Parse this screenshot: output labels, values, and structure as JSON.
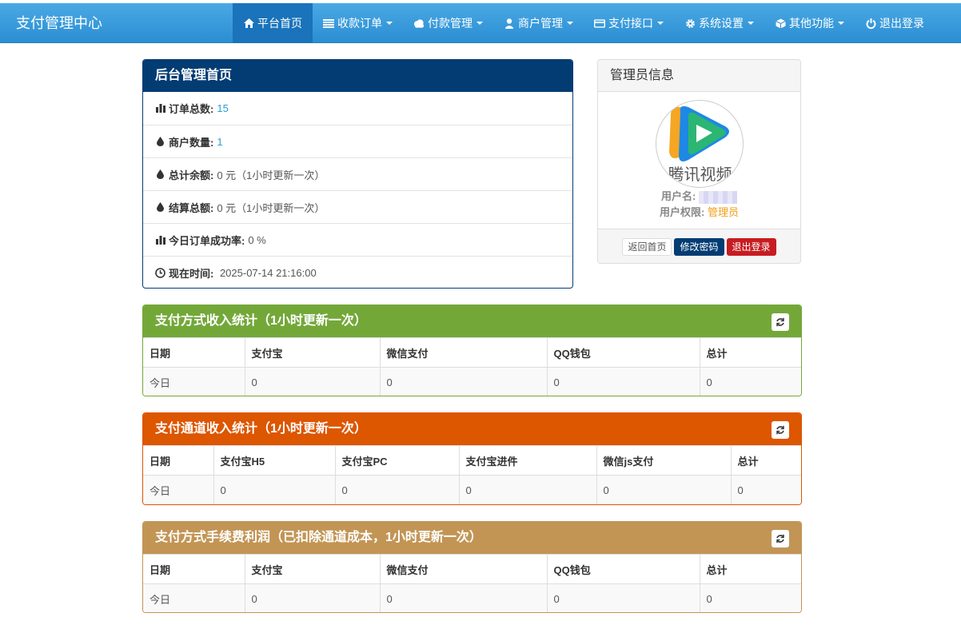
{
  "brand": "支付管理中心",
  "nav": [
    {
      "label": "平台首页",
      "icon": "home-icon",
      "active": true,
      "caret": false
    },
    {
      "label": "收款订单",
      "icon": "list-icon",
      "active": false,
      "caret": true
    },
    {
      "label": "付款管理",
      "icon": "cloud-icon",
      "active": false,
      "caret": true
    },
    {
      "label": "商户管理",
      "icon": "user-icon",
      "active": false,
      "caret": true
    },
    {
      "label": "支付接口",
      "icon": "credit-card-icon",
      "active": false,
      "caret": true
    },
    {
      "label": "系统设置",
      "icon": "gear-icon",
      "active": false,
      "caret": true
    },
    {
      "label": "其他功能",
      "icon": "cube-icon",
      "active": false,
      "caret": true
    },
    {
      "label": "退出登录",
      "icon": "power-icon",
      "active": false,
      "caret": false
    }
  ],
  "home": {
    "title": "后台管理首页",
    "rows": [
      {
        "icon": "bar-chart-icon",
        "label": "订单总数:",
        "value": "15",
        "link": true
      },
      {
        "icon": "drop-icon",
        "label": "商户数量:",
        "value": "1",
        "link": true
      },
      {
        "icon": "drop-icon",
        "label": "总计余额:",
        "value": "0 元（1小时更新一次）",
        "link": false
      },
      {
        "icon": "drop-icon",
        "label": "结算总额:",
        "value": "0 元（1小时更新一次）",
        "link": false
      },
      {
        "icon": "bar-chart-icon",
        "label": "今日订单成功率:",
        "value": "0 %",
        "link": false
      },
      {
        "icon": "clock-icon",
        "label": "现在时间:",
        "value": " 2025-07-14 21:16:00",
        "link": false
      }
    ]
  },
  "admin": {
    "title": "管理员信息",
    "avatar_text": "腾讯视频",
    "username_label": "用户名:",
    "role_label": "用户权限:",
    "role_value": "管理员",
    "btn_home": "返回首页",
    "btn_password": "修改密码",
    "btn_logout": "退出登录"
  },
  "tables": [
    {
      "title": "支付方式收入统计（1小时更新一次）",
      "color": "#73a839",
      "headers": [
        "日期",
        "支付宝",
        "微信支付",
        "QQ钱包",
        "总计"
      ],
      "row": [
        "今日",
        "0",
        "0",
        "0",
        "0"
      ]
    },
    {
      "title": "支付通道收入统计（1小时更新一次）",
      "color": "#dd5600",
      "headers": [
        "日期",
        "支付宝H5",
        "支付宝PC",
        "支付宝进件",
        "微信js支付",
        "总计"
      ],
      "row": [
        "今日",
        "0",
        "0",
        "0",
        "0",
        "0"
      ]
    },
    {
      "title": "支付方式手续费利润（已扣除通道成本，1小时更新一次）",
      "color": "#c29555",
      "headers": [
        "日期",
        "支付宝",
        "微信支付",
        "QQ钱包",
        "总计"
      ],
      "row": [
        "今日",
        "0",
        "0",
        "0",
        "0"
      ]
    }
  ]
}
